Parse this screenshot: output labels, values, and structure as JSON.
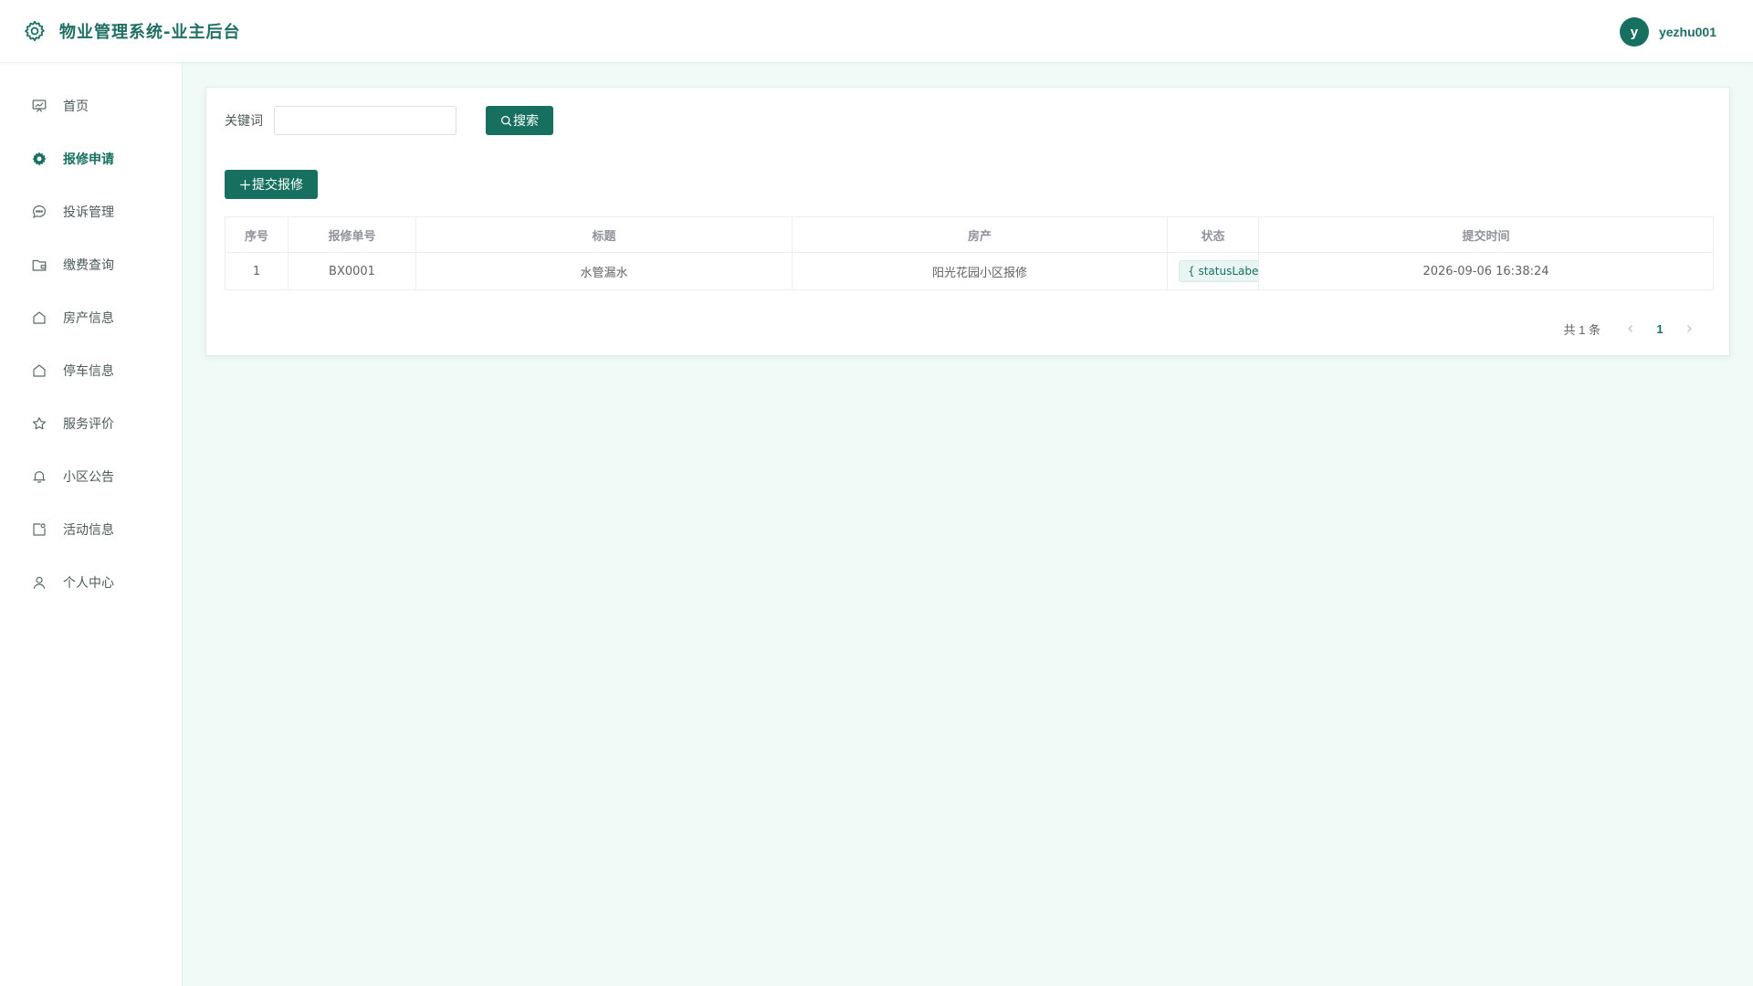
{
  "header": {
    "logo_icon": "gear-icon",
    "title": "物业管理系统-业主后台",
    "avatar_letter": "y",
    "username": "yezhu001",
    "accent_color": "#17705f"
  },
  "sidebar": {
    "items": [
      {
        "label": "首页",
        "icon": "chart-board-icon",
        "active": false
      },
      {
        "label": "报修申请",
        "icon": "gear-icon",
        "active": true
      },
      {
        "label": "投诉管理",
        "icon": "chat-bubble-icon",
        "active": false
      },
      {
        "label": "缴费查询",
        "icon": "wallet-icon",
        "active": false
      },
      {
        "label": "房产信息",
        "icon": "house-icon",
        "active": false
      },
      {
        "label": "停车信息",
        "icon": "house-icon",
        "active": false
      },
      {
        "label": "服务评价",
        "icon": "star-icon",
        "active": false
      },
      {
        "label": "小区公告",
        "icon": "bell-icon",
        "active": false
      },
      {
        "label": "活动信息",
        "icon": "activity-icon",
        "active": false
      },
      {
        "label": "个人中心",
        "icon": "user-icon",
        "active": false
      }
    ]
  },
  "search": {
    "label": "关键词",
    "value": "",
    "placeholder": "",
    "button_label": "搜索"
  },
  "actions": {
    "add_label": "提交报修"
  },
  "table": {
    "columns": [
      "序号",
      "报修单号",
      "标题",
      "房产",
      "状态",
      "提交时间"
    ],
    "rows": [
      {
        "index": "1",
        "order_no": "BX0001",
        "title": "水管漏水",
        "property": "阳光花园小区报修",
        "status": "{ statusLabel(r",
        "time": "2026-09-06 16:38:24"
      }
    ]
  },
  "pagination": {
    "total_text": "共 1 条",
    "current_page": "1"
  }
}
